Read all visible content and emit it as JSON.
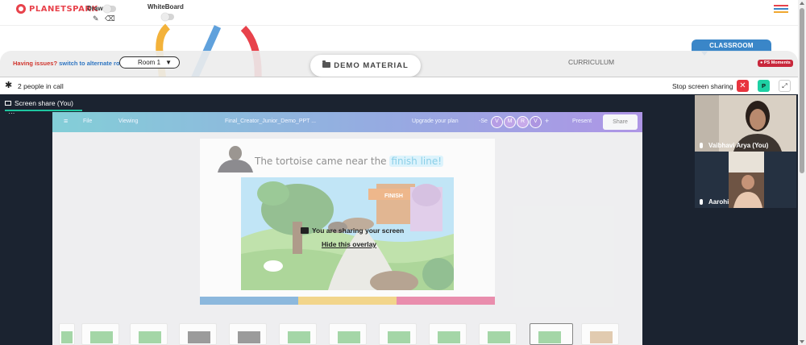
{
  "brand": {
    "name": "PLANETSPARK"
  },
  "toolbar": {
    "draw_label": "Draw",
    "whiteboard_label": "WhiteBoard"
  },
  "nav": {
    "issues_text": "Having issues?",
    "alternate_room_link": "switch to alternate room",
    "room_select": "Room 1",
    "demo_material": "DEMO MATERIAL",
    "curriculum": "CURRICULUM",
    "classroom_tab": "CLASSROOM",
    "ps_moments": "PS Moments"
  },
  "call": {
    "people_count": "2 people in call",
    "stop_sharing": "Stop screen sharing",
    "p_badge": "P",
    "screen_share_tab": "Screen share (You)",
    "more": "···"
  },
  "canva": {
    "menu_file": "File",
    "menu_viewing": "Viewing",
    "doc_title": "Final_Creator_Junior_Demo_PPT ...",
    "upgrade": "Upgrade your plan",
    "avatars": [
      "V",
      "M",
      "R",
      "V"
    ],
    "plus": "+",
    "present": "Present",
    "share": "Share"
  },
  "slide": {
    "title_prefix": "The tortoise came near the",
    "title_highlight": "finish line!",
    "finish_banner": "FINISH"
  },
  "overlay": {
    "sharing_message": "You are sharing your screen",
    "hide_link": "Hide this overlay"
  },
  "participants": [
    {
      "name": "Vaibhavi Arya (You)"
    },
    {
      "name": "Aarohi"
    }
  ],
  "colors": {
    "brand_red": "#e8424b",
    "classroom_blue": "#3a86c8",
    "stop_red": "#e8343e",
    "badge_teal": "#1ed1a4",
    "tab_underline": "#1ec6a0",
    "video_bg": "#1b2330"
  }
}
